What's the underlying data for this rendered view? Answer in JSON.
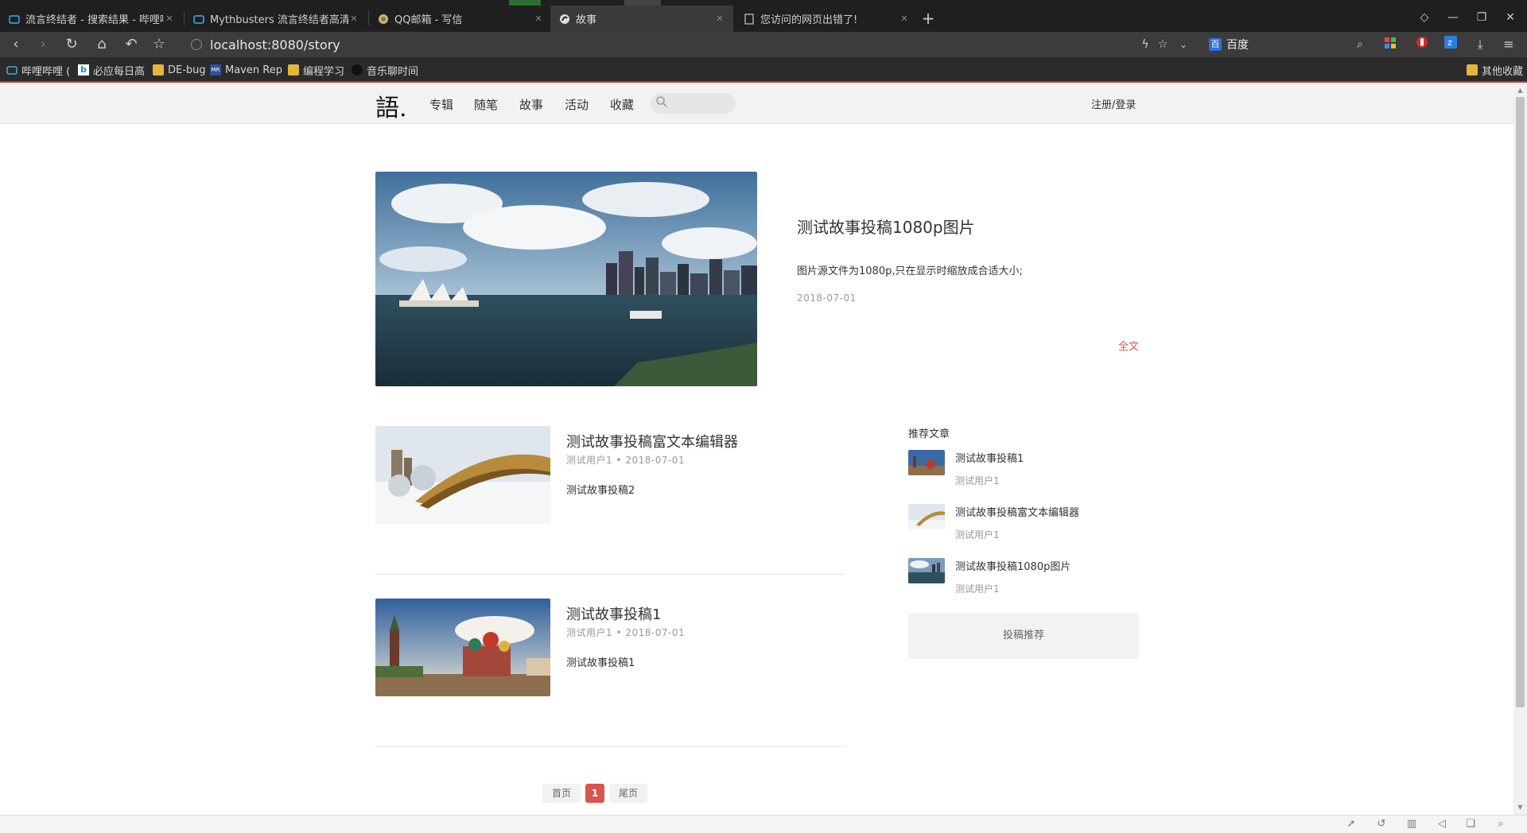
{
  "browser": {
    "tabs": [
      {
        "title": "流言终结者 - 搜索结果 - 哔哩哔",
        "icon": "bilibili-icon",
        "active": false
      },
      {
        "title": "Mythbusters 流言终结者高清系",
        "icon": "bilibili-icon",
        "active": false
      },
      {
        "title": "QQ邮箱 - 写信",
        "icon": "chrome-icon",
        "active": false
      },
      {
        "title": "故事",
        "icon": "page-icon",
        "active": true
      },
      {
        "title": "您访问的网页出错了!",
        "icon": "document-icon",
        "active": false
      }
    ],
    "address": "localhost:8080/story",
    "search_engine": "百度",
    "bookmarks": [
      {
        "label": "哔哩哔哩 (",
        "icon": "bilibili-icon"
      },
      {
        "label": "必应每日高",
        "icon": "bing-icon"
      },
      {
        "label": "DE-bug",
        "icon": "folder-icon"
      },
      {
        "label": "Maven Rep",
        "icon": "maven-icon"
      },
      {
        "label": "编程学习",
        "icon": "folder-icon"
      },
      {
        "label": "音乐聊时间",
        "icon": "music-icon"
      }
    ],
    "other_bookmarks": "其他收藏"
  },
  "site": {
    "logo": "語.",
    "nav": [
      "专辑",
      "随笔",
      "故事",
      "活动",
      "收藏"
    ],
    "search_placeholder": "",
    "login": "注册/登录"
  },
  "hero": {
    "title": "测试故事投稿1080p图片",
    "desc": "图片源文件为1080p,只在显示时缩放成合适大小;",
    "date": "2018-07-01",
    "more": "全文"
  },
  "posts": [
    {
      "title": "测试故事投稿富文本编辑器",
      "meta": "测试用户1 • 2018-07-01",
      "desc": "测试故事投稿2"
    },
    {
      "title": "测试故事投稿1",
      "meta": "测试用户1 • 2018-07-01",
      "desc": "测试故事投稿1"
    }
  ],
  "sidebar": {
    "title": "推荐文章",
    "items": [
      {
        "title": "测试故事投稿1",
        "user": "测试用户1"
      },
      {
        "title": "测试故事投稿富文本编辑器",
        "user": "测试用户1"
      },
      {
        "title": "测试故事投稿1080p图片",
        "user": "测试用户1"
      }
    ],
    "submit": "投稿推荐"
  },
  "pager": {
    "first": "首页",
    "current": "1",
    "last": "尾页"
  },
  "colors": {
    "accent": "#d9534f",
    "header_bg": "#f2f2f2"
  }
}
